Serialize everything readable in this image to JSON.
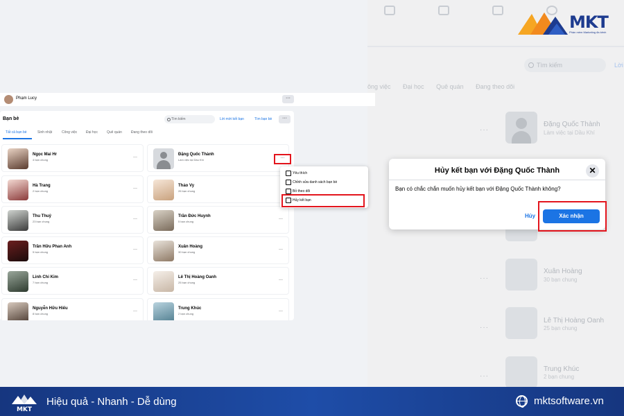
{
  "brand": {
    "name": "MKT",
    "tagline": "Phần mềm Marketing đa kênh",
    "slogan": "Hiệu quả - Nhanh - Dễ dùng",
    "website": "mktsoftware.vn",
    "colors": {
      "navy": "#1d3b8f",
      "orange": "#f6a623",
      "highlight": "#e3141c",
      "fb_blue": "#1b74e4"
    }
  },
  "background": {
    "search_placeholder": "Tìm kiếm",
    "link_fragment": "Lời",
    "tabs": [
      "ông việc",
      "Đại học",
      "Quê quán",
      "Đang theo dõi"
    ],
    "cards": [
      {
        "name": "Đặng Quốc Thành",
        "sub": "Làm việc tại Dầu Khí"
      },
      {
        "name": "Xuân Hoàng",
        "sub": "30 bạn chung"
      },
      {
        "name": "Lê Thị Hoàng Oanh",
        "sub": "25 bạn chung"
      },
      {
        "name": "Trung Khúc",
        "sub": "2 bạn chung"
      }
    ]
  },
  "topbar": {
    "user_name": "Phạm Lucy",
    "more": "···"
  },
  "friends": {
    "title": "Bạn bè",
    "search_placeholder": "Tìm kiếm",
    "requests_link": "Lời mời kết bạn",
    "find_link": "Tìm bạn bè",
    "more": "···",
    "tabs": [
      "Tất cả bạn bè",
      "Sinh nhật",
      "Công việc",
      "Đại học",
      "Quê quán",
      "Đang theo dõi"
    ],
    "dots": "···",
    "list": [
      {
        "name": "Ngọc Mai Hr",
        "sub": "4 bạn chung"
      },
      {
        "name": "Đặng Quốc Thành",
        "sub": "Làm việc tại Dầu Khí"
      },
      {
        "name": "Hà Trang",
        "sub": "2 bạn chung"
      },
      {
        "name": "Thảo Vy",
        "sub": "26 bạn chung"
      },
      {
        "name": "Thu Thuỷ",
        "sub": "23 bạn chung"
      },
      {
        "name": "Trần Đức Huynh",
        "sub": "5 bạn chung"
      },
      {
        "name": "Trần Hữu Phan Anh",
        "sub": "5 bạn chung"
      },
      {
        "name": "Xuân Hoàng",
        "sub": "30 bạn chung"
      },
      {
        "name": "Linh Chi Kim",
        "sub": "7 bạn chung"
      },
      {
        "name": "Lê Thị Hoàng Oanh",
        "sub": "25 bạn chung"
      },
      {
        "name": "Nguyễn Hữu Hiếu",
        "sub": "8 bạn chung"
      },
      {
        "name": "Trung Khúc",
        "sub": "2 bạn chung"
      }
    ]
  },
  "menu": {
    "items": [
      "Yêu thích",
      "Chỉnh sửa danh sách bạn bè",
      "Bỏ theo dõi",
      "Hủy kết bạn"
    ]
  },
  "modal": {
    "title": "Hủy kết bạn với Đặng Quốc Thành",
    "close": "✕",
    "body": "Bạn có chắc chắn muốn hủy kết bạn với Đặng Quốc Thành không?",
    "cancel": "Hủy",
    "confirm": "Xác nhận"
  }
}
